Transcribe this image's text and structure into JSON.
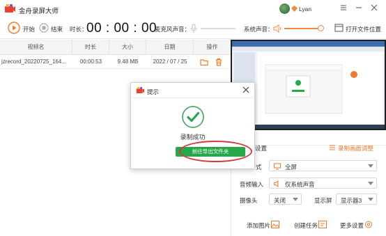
{
  "app": {
    "title": "金舟录屏大师",
    "username": "Lyan"
  },
  "toolbar": {
    "start_label": "开始",
    "stop_label": "结束",
    "duration_label": "时长：",
    "timer": "00 : 00 : 00",
    "mic_label": "麦克风声音：",
    "system_sound_label": "系统声音：",
    "open_folder_label": "打开文件位置"
  },
  "table": {
    "headers": [
      "视频名",
      "时长",
      "大小",
      "日期",
      "操作"
    ],
    "rows": [
      {
        "name": "jzrecord_20220725_164...",
        "duration": "00:00:53",
        "size": "9.48 MB",
        "date": "2022 / 07 / 25"
      }
    ]
  },
  "settings": {
    "title": "设置",
    "adjust_link": "录制画面调整",
    "mode_label": "式",
    "mode_value": "全屏",
    "audio_label": "音频输入",
    "audio_value": "仅系统声音",
    "camera_label": "摄像头",
    "camera_value": "关闭",
    "display_label": "显示屏",
    "display_value": "显示器3",
    "add_image": "添加图片",
    "create_task": "创建任务",
    "more_settings": "更多设置"
  },
  "dialog": {
    "title": "提示",
    "message": "录制成功",
    "button": "前往导出文件夹"
  },
  "colors": {
    "accent": "#f07a2a",
    "success": "#25a74a",
    "highlight": "#d63b3b"
  }
}
